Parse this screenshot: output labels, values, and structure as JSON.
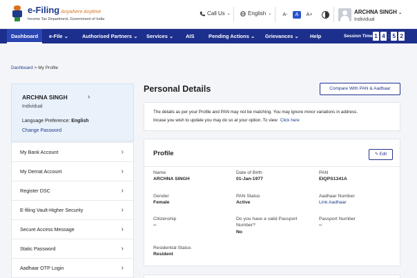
{
  "header": {
    "logo_title": "e-Filing",
    "logo_tagline": "Anywhere Anytime",
    "logo_subtitle": "Income Tax Department, Government of India",
    "call_us": "Call Us",
    "language": "English",
    "font_small": "A-",
    "font_normal": "A",
    "font_large": "A+",
    "user_name": "ARCHNA SINGH",
    "user_role": "Individual"
  },
  "nav": {
    "items": [
      "Dashboard",
      "e-File",
      "Authorised Partners",
      "Services",
      "AIS",
      "Pending Actions",
      "Grievances",
      "Help"
    ],
    "session_label": "Session Time",
    "session_digits": [
      "1",
      "4",
      "5",
      "2"
    ]
  },
  "breadcrumb": {
    "home": "Dashboard",
    "separator": ">",
    "current": "My Profile"
  },
  "sidebar": {
    "name": "ARCHNA SINGH",
    "role": "Individual",
    "language_label": "Language Preference:",
    "language_value": "English",
    "change_password": "Change Password",
    "menu": [
      "My Bank Account",
      "My Demat Account",
      "Register DSC",
      "E-filing Vault-Higher Security",
      "Secure Access Message",
      "Static Password",
      "Aadhaar OTP Login"
    ]
  },
  "main": {
    "title": "Personal Details",
    "compare_button": "Compare With PAN & Aadhaar",
    "notice_line1": "The details as per your Profile and PAN may not be matching. You may ignore minor variations in address.",
    "notice_line2": "Incase you wish to update you may do so at your option. To view",
    "notice_link": "Click here",
    "profile_title": "Profile",
    "edit_button": "Edit",
    "fields": {
      "name_label": "Name",
      "name_value": "ARCHNA SINGH",
      "dob_label": "Date of Birth",
      "dob_value": "01-Jan-1977",
      "pan_label": "PAN",
      "pan_value": "EIQPS1341A",
      "gender_label": "Gender",
      "gender_value": "Female",
      "pan_status_label": "PAN Status",
      "pan_status_value": "Active",
      "aadhaar_label": "Aadhaar Number",
      "aadhaar_value": "Link Aadhaar",
      "citizenship_label": "Citizenship",
      "citizenship_value": "--",
      "passport_q_line1": "Do you have a valid Passport",
      "passport_q_line2": "Number?",
      "passport_q_value": "No",
      "passport_no_label": "Passport Number",
      "passport_no_value": "--",
      "residential_label": "Residential Status",
      "residential_value": "Resident"
    }
  },
  "colors": {
    "nav_bg": "#1d2f8c",
    "link": "#1d3a8a",
    "page_bg": "#f3f5f9"
  }
}
